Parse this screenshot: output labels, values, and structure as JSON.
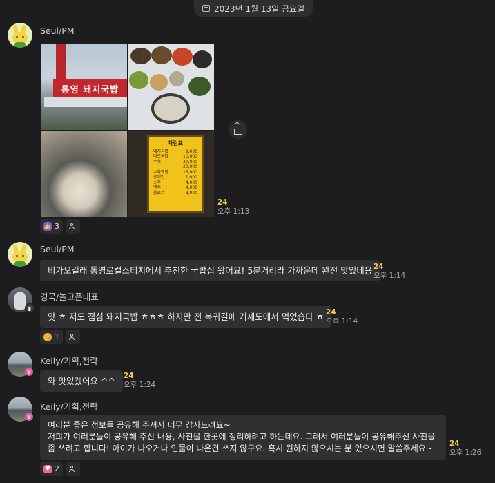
{
  "date_divider": "2023년 1월 13일 금요일",
  "messages": [
    {
      "sender": "Seul/PM",
      "image_menu": {
        "title": "차림표",
        "shop_sign": "통영 돼지국밥",
        "items": [
          [
            "돼지국밥",
            "9,000"
          ],
          [
            "따로국밥",
            "10,000"
          ],
          [
            "수육",
            "30,000"
          ],
          [
            "",
            "20,000"
          ],
          [
            "수육백반",
            "13,000"
          ],
          [
            "공기밥",
            "1,000"
          ],
          [
            "소주",
            "4,000"
          ],
          [
            "맥주",
            "4,000"
          ],
          [
            "음료수",
            "3,000"
          ]
        ]
      },
      "count": "24",
      "time": "오후 1:13",
      "reactions": [
        {
          "emoji": "thumbs-up",
          "count": "3"
        }
      ]
    },
    {
      "sender": "Seul/PM",
      "text": "비가오길래 통영로컬스티치에서 추천한 국밥집 왔어요! 5분거리라 가까운데 완전 맛있네용",
      "count": "24",
      "time": "오후 1:14"
    },
    {
      "sender": "경국/놀고픈대표",
      "text": "앗 ㅎ 저도 점심 돼지국밥 ㅎㅎㅎ 하지만 전 복귀길에 거제도에서 먹었습다 ㅎ",
      "count": "24",
      "time": "오후 1:14",
      "reactions": [
        {
          "emoji": "smile",
          "count": "1"
        }
      ]
    },
    {
      "sender": "Keily/기획,전략",
      "text": "와 맛있겠어요 ^^",
      "count": "24",
      "time": "오후 1:24"
    },
    {
      "sender": "Keily/기획,전략",
      "text": "여러분 좋은 정보들 공유해 주셔서 너무 감사드려요~\n저희가 여러분들이 공유해 주신 내용, 사진을 한곳에 정리하려고 하는데요. 그래서 여러분들이 공유해주신 사진을\n좀 쓰려고 합니다! 아이가 나오거나 인물이 나온건 쓰지 않구요. 혹시 원하지 않으시는 분 있으시면 말씀주세요~",
      "count": "24",
      "time": "오후 1:26",
      "reactions": [
        {
          "emoji": "heart",
          "count": "2"
        }
      ]
    }
  ]
}
